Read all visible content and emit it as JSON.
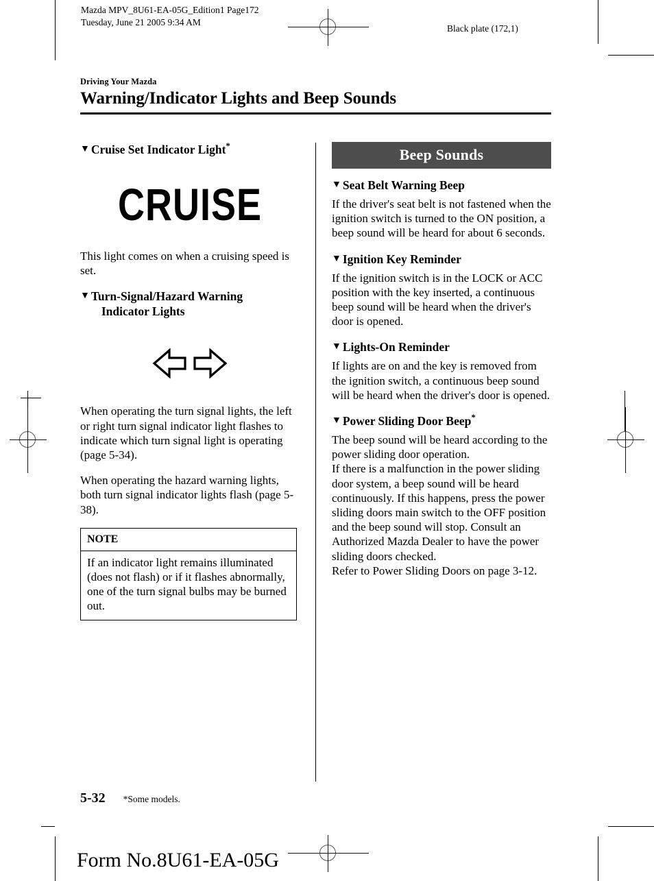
{
  "print_marks": {
    "slug_line1": "Mazda MPV_8U61-EA-05G_Edition1  Page172",
    "slug_line2": "Tuesday, June 21 2005 9:34 AM",
    "black_plate": "Black plate (172,1)"
  },
  "header": {
    "chapter": "Driving Your Mazda",
    "title": "Warning/Indicator Lights and Beep Sounds"
  },
  "left_column": {
    "cruise_section": {
      "heading": "Cruise Set Indicator Light",
      "heading_star": "*",
      "indicator_graphic_text": "CRUISE",
      "body": "This light comes on when a cruising speed is set."
    },
    "turn_signal_section": {
      "heading_line1": "Turn-Signal/Hazard Warning",
      "heading_line2": "Indicator Lights",
      "left_arrow_icon": "left-block-arrow",
      "right_arrow_icon": "right-block-arrow",
      "paragraph1": "When operating the turn signal lights, the left or right turn signal indicator light flashes to indicate which turn signal light is operating (page 5-34).",
      "paragraph2": "When operating the hazard warning lights, both turn signal indicator lights flash (page 5-38)."
    },
    "note_box": {
      "title": "NOTE",
      "text": "If an indicator light remains illuminated (does not flash) or if it flashes abnormally, one of the turn signal bulbs may be burned out."
    }
  },
  "right_column": {
    "band_title": "Beep Sounds",
    "sections": [
      {
        "heading": "Seat Belt Warning Beep",
        "heading_star": "",
        "body": "If the driver's seat belt is not fastened when the ignition switch is turned to the ON position, a beep sound will be heard for about 6 seconds."
      },
      {
        "heading": "Ignition Key Reminder",
        "heading_star": "",
        "body": "If the ignition switch is in the LOCK or ACC position with the key inserted, a continuous beep sound will be heard when the driver's door is opened."
      },
      {
        "heading": "Lights-On Reminder",
        "heading_star": "",
        "body": "If lights are on and the key is removed from the ignition switch, a continuous beep sound will be heard when the driver's door is opened."
      },
      {
        "heading": "Power Sliding Door Beep",
        "heading_star": "*",
        "body": "The beep sound will be heard according to the power sliding door operation.\nIf there is a malfunction in the power sliding door system, a beep sound will be heard continuously. If this happens, press the power sliding doors main switch to the OFF position and the beep sound will stop. Consult an Authorized Mazda Dealer to have the power sliding doors checked.\nRefer to Power Sliding Doors on page 3-12."
      }
    ]
  },
  "footer": {
    "page_number": "5-32",
    "footnote": "*Some models.",
    "form_number": "Form No.8U61-EA-05G"
  },
  "colors": {
    "band_background": "#4d4d4d",
    "band_text": "#ffffff",
    "rule": "#000000",
    "page_background": "#ffffff"
  },
  "icons": {
    "section_bullet": "▼"
  }
}
